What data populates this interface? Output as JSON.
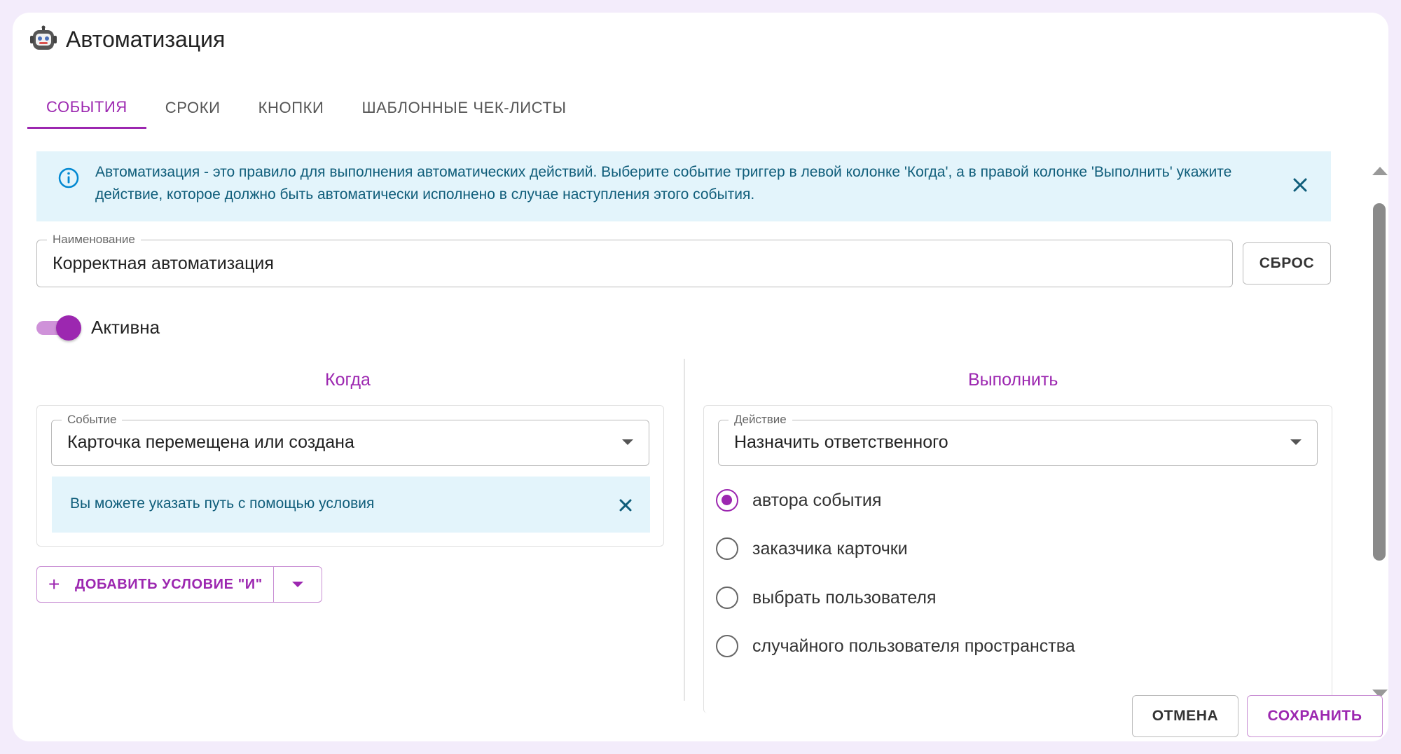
{
  "dialog": {
    "title": "Автоматизация",
    "icon": "robot-icon"
  },
  "tabs": [
    {
      "label": "СОБЫТИЯ",
      "active": true
    },
    {
      "label": "СРОКИ",
      "active": false
    },
    {
      "label": "КНОПКИ",
      "active": false
    },
    {
      "label": "ШАБЛОННЫЕ ЧЕК-ЛИСТЫ",
      "active": false
    }
  ],
  "info_banner": {
    "text": "Автоматизация - это правило для выполнения автоматических действий. Выберите событие триггер в левой колонке 'Когда', а в правой колонке 'Выполнить' укажите действие, которое должно быть автоматически исполнено в случае наступления этого события."
  },
  "name_field": {
    "label": "Наименование",
    "value": "Корректная автоматизация",
    "reset_label": "СБРОС"
  },
  "active_toggle": {
    "label": "Активна",
    "checked": true
  },
  "when": {
    "heading": "Когда",
    "event_label": "Событие",
    "event_value": "Карточка перемещена или создана",
    "hint": "Вы можете указать путь с помощью условия",
    "add_condition_label": "ДОБАВИТЬ УСЛОВИЕ \"И\""
  },
  "execute": {
    "heading": "Выполнить",
    "action_label": "Действие",
    "action_value": "Назначить ответственного",
    "options": [
      {
        "label": "автора события",
        "checked": true
      },
      {
        "label": "заказчика карточки",
        "checked": false
      },
      {
        "label": "выбрать пользователя",
        "checked": false
      },
      {
        "label": "случайного пользователя пространства",
        "checked": false
      }
    ]
  },
  "footer": {
    "cancel_label": "ОТМЕНА",
    "save_label": "СОХРАНИТЬ"
  },
  "colors": {
    "accent": "#9c27b0",
    "info_bg": "#e3f4fb",
    "info_text": "#0f5d7a",
    "page_bg": "#f3ecfb"
  }
}
